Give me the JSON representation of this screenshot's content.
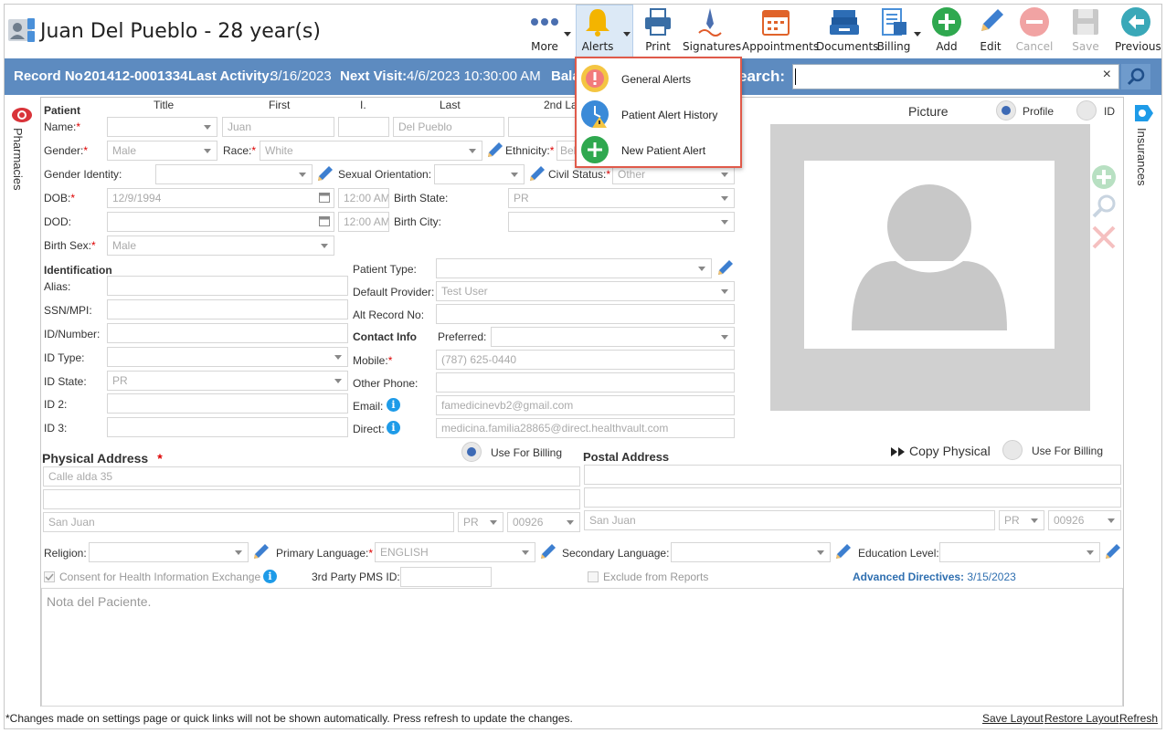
{
  "header": {
    "patient_title": "Juan Del Pueblo - 28 year(s)"
  },
  "toolbar": {
    "more": "More",
    "alerts": "Alerts",
    "print": "Print",
    "signatures": "Signatures",
    "appointments": "Appointments",
    "documents": "Documents",
    "billing": "Billing",
    "add": "Add",
    "edit": "Edit",
    "cancel": "Cancel",
    "save": "Save",
    "previous": "Previous"
  },
  "infobar": {
    "record_label": "Record No:",
    "record_value": "201412-0001334",
    "activity_label": "Last Activity:",
    "activity_value": "3/16/2023",
    "next_label": "Next Visit:",
    "next_value": "4/6/2023 10:30:00 AM",
    "balance_label": "Bala",
    "search_label": "earch:",
    "search_clear": "×"
  },
  "alerts_menu": {
    "items": [
      {
        "label": "General Alerts"
      },
      {
        "label": "Patient Alert History"
      },
      {
        "label": "New Patient Alert"
      }
    ]
  },
  "side_tabs": {
    "left": "Pharmacies",
    "right": "Insurances"
  },
  "patient": {
    "section": "Patient",
    "col_title": "Title",
    "col_first": "First",
    "col_i": "I.",
    "col_last": "Last",
    "col_2nd": "2nd La",
    "name_label": "Name:",
    "first_value": "Juan",
    "last_value": "Del Pueblo",
    "gender_label": "Gender:",
    "gender_value": "Male",
    "race_label": "Race:",
    "race_value": "White",
    "ethnicity_label": "Ethnicity:",
    "ethnicity_value": "Bel",
    "gender_identity_label": "Gender Identity:",
    "sexual_orientation_label": "Sexual Orientation:",
    "civil_status_label": "Civil Status:",
    "civil_status_value": "Other",
    "dob_label": "DOB:",
    "dob_value": "12/9/1994",
    "dob_time": "12:00 AM",
    "birth_state_label": "Birth State:",
    "birth_state_value": "PR",
    "dod_label": "DOD:",
    "dod_time": "12:00 AM",
    "birth_city_label": "Birth City:",
    "birth_sex_label": "Birth Sex:",
    "birth_sex_value": "Male"
  },
  "identification": {
    "section": "Identification",
    "alias_label": "Alias:",
    "ssn_label": "SSN/MPI:",
    "id_number_label": "ID/Number:",
    "id_type_label": "ID Type:",
    "id_state_label": "ID State:",
    "id_state_value": "PR",
    "id2_label": "ID 2:",
    "id3_label": "ID 3:",
    "patient_type_label": "Patient Type:",
    "default_provider_label": "Default Provider:",
    "default_provider_value": "Test User",
    "alt_record_label": "Alt Record No:"
  },
  "contact": {
    "section": "Contact Info",
    "preferred_label": "Preferred:",
    "mobile_label": "Mobile:",
    "mobile_value": "(787) 625-0440",
    "other_phone_label": "Other Phone:",
    "email_label": "Email:",
    "email_value": "famedicinevb2@gmail.com",
    "direct_label": "Direct:",
    "direct_value": "medicina.familia28865@direct.healthvault.com"
  },
  "picture": {
    "label": "Picture",
    "profile_label": "Profile",
    "id_label": "ID"
  },
  "physical_address": {
    "section": "Physical Address",
    "use_for_billing": "Use For Billing",
    "line1": "Calle alda 35",
    "city": "San Juan",
    "state": "PR",
    "zip": "00926"
  },
  "postal_address": {
    "section": "Postal Address",
    "copy_physical": "Copy Physical",
    "use_for_billing": "Use For Billing",
    "city": "San Juan",
    "state": "PR",
    "zip": "00926"
  },
  "misc": {
    "religion_label": "Religion:",
    "primary_language_label": "Primary Language:",
    "primary_language_value": "ENGLISH",
    "secondary_language_label": "Secondary Language:",
    "education_label": "Education Level:",
    "consent_label": "Consent for Health Information Exchange",
    "third_party_label": "3rd Party PMS ID:",
    "exclude_label": "Exclude from Reports",
    "advanced_directives_label": "Advanced Directives:",
    "advanced_directives_value": "3/15/2023",
    "notes_placeholder": "Nota del Paciente."
  },
  "footer": {
    "message": "*Changes made on settings page or quick links will not be shown automatically. Press refresh to update the changes.",
    "save_layout": "Save Layout",
    "restore_layout": "Restore Layout",
    "refresh": "Refresh"
  }
}
